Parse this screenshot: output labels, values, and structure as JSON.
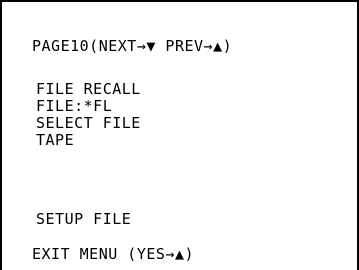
{
  "menu": {
    "header": "PAGE10(NEXT→▼ PREV→▲)",
    "items": [
      "FILE RECALL",
      "FILE:*FL",
      "SELECT FILE",
      "TAPE",
      "SETUP FILE"
    ],
    "exit": "EXIT MENU (YES→▲)"
  }
}
